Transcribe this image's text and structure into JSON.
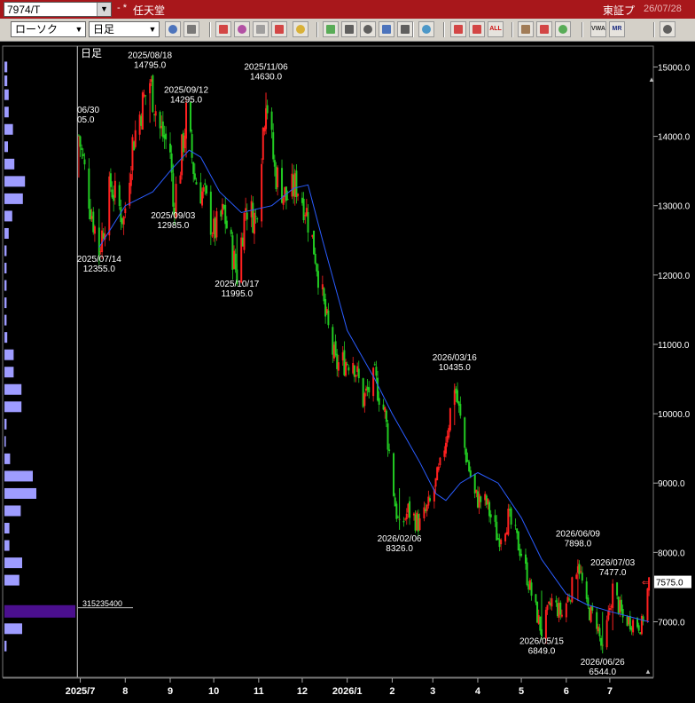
{
  "header": {
    "symbol": "7974/T",
    "mark": "- *",
    "company": "任天堂",
    "exchange": "東証プ",
    "date": "26/07/28"
  },
  "toolbar": {
    "chart_type": "ローソク",
    "period": "日足",
    "buttons": [
      {
        "icon": "search-icon",
        "label": ""
      },
      {
        "icon": "layout-icon",
        "label": ""
      },
      {
        "icon": "cursor-icon",
        "label": ""
      },
      {
        "icon": "zoom-icon",
        "label": ""
      },
      {
        "icon": "table-icon",
        "label": ""
      },
      {
        "icon": "arrows-icon",
        "label": ""
      },
      {
        "icon": "warning-icon",
        "label": ""
      },
      {
        "icon": "pencil-icon",
        "label": ""
      },
      {
        "icon": "line-tool-icon",
        "label": ""
      },
      {
        "icon": "select-tool-icon",
        "label": ""
      },
      {
        "icon": "arrow-tool-icon",
        "label": ""
      },
      {
        "icon": "memo-icon",
        "label": ""
      },
      {
        "icon": "trash-icon",
        "label": ""
      },
      {
        "icon": "candle-icon",
        "label": ""
      },
      {
        "icon": "candle-delete-icon",
        "label": ""
      },
      {
        "icon": "all-delete-icon",
        "label": "ALL"
      },
      {
        "icon": "settings-icon",
        "label": ""
      },
      {
        "icon": "brush-icon",
        "label": ""
      },
      {
        "icon": "color-icon",
        "label": ""
      },
      {
        "icon": "volume-icon",
        "label": "VWAP"
      },
      {
        "icon": "mr-icon",
        "label": "MR"
      },
      {
        "icon": "list-icon",
        "label": ""
      }
    ]
  },
  "colors": {
    "background": "#000000",
    "up_candle": "#ff2020",
    "down_candle": "#22cc22",
    "moving_average": "#2a5cff",
    "volume_profile": "#9e9cff",
    "volume_profile_max": "#4b0f8e",
    "current_price_bg": "#ffffff"
  },
  "chart_data": {
    "type": "candlestick",
    "period_label": "日足",
    "y_ticks": [
      7000.0,
      8000.0,
      9000.0,
      10000.0,
      11000.0,
      12000.0,
      13000.0,
      14000.0,
      15000.0
    ],
    "y_tick_labels": [
      "7000.0",
      "8000.0",
      "9000.0",
      "10000.0",
      "11000.0",
      "12000.0",
      "13000.0",
      "14000.0",
      "15000.0"
    ],
    "ylim": [
      6200,
      15300
    ],
    "x_tick_labels": [
      "2025/7",
      "8",
      "9",
      "10",
      "11",
      "12",
      "2026/1",
      "2",
      "3",
      "4",
      "5",
      "6",
      "7"
    ],
    "x_tick_dates": [
      "2025-07-01",
      "2025-08-01",
      "2025-09-01",
      "2025-10-01",
      "2025-11-01",
      "2025-12-01",
      "2026-01-01",
      "2026-02-01",
      "2026-03-01",
      "2026-04-01",
      "2026-05-01",
      "2026-06-01",
      "2026-07-01"
    ],
    "x_range": [
      "2025-06-27",
      "2026-07-31"
    ],
    "current_price": 7575.0,
    "current_price_label": "7575.0",
    "close_path": [
      [
        "2025-06-30",
        14005
      ],
      [
        "2025-07-08",
        13000
      ],
      [
        "2025-07-14",
        12355
      ],
      [
        "2025-07-22",
        13300
      ],
      [
        "2025-07-31",
        12800
      ],
      [
        "2025-08-06",
        13900
      ],
      [
        "2025-08-12",
        14400
      ],
      [
        "2025-08-18",
        14795
      ],
      [
        "2025-08-25",
        14100
      ],
      [
        "2025-09-01",
        13800
      ],
      [
        "2025-09-03",
        12985
      ],
      [
        "2025-09-08",
        13600
      ],
      [
        "2025-09-12",
        14295
      ],
      [
        "2025-09-18",
        13400
      ],
      [
        "2025-09-25",
        13100
      ],
      [
        "2025-10-01",
        12600
      ],
      [
        "2025-10-08",
        12900
      ],
      [
        "2025-10-17",
        11995
      ],
      [
        "2025-10-23",
        13000
      ],
      [
        "2025-10-30",
        12800
      ],
      [
        "2025-11-06",
        14630
      ],
      [
        "2025-11-12",
        13500
      ],
      [
        "2025-11-20",
        13100
      ],
      [
        "2025-11-27",
        13300
      ],
      [
        "2025-12-03",
        13000
      ],
      [
        "2025-12-10",
        12300
      ],
      [
        "2025-12-17",
        11400
      ],
      [
        "2025-12-24",
        10700
      ],
      [
        "2026-01-05",
        10800
      ],
      [
        "2026-01-12",
        10200
      ],
      [
        "2026-01-20",
        10500
      ],
      [
        "2026-01-27",
        10000
      ],
      [
        "2026-02-03",
        8700
      ],
      [
        "2026-02-06",
        8326
      ],
      [
        "2026-02-12",
        8600
      ],
      [
        "2026-02-20",
        8400
      ],
      [
        "2026-02-27",
        8700
      ],
      [
        "2026-03-06",
        9200
      ],
      [
        "2026-03-12",
        9900
      ],
      [
        "2026-03-16",
        10435
      ],
      [
        "2026-03-23",
        9500
      ],
      [
        "2026-03-30",
        8800
      ],
      [
        "2026-04-07",
        8700
      ],
      [
        "2026-04-15",
        8200
      ],
      [
        "2026-04-22",
        8500
      ],
      [
        "2026-05-01",
        8000
      ],
      [
        "2026-05-08",
        7400
      ],
      [
        "2026-05-15",
        6849
      ],
      [
        "2026-05-22",
        7300
      ],
      [
        "2026-05-29",
        7100
      ],
      [
        "2026-06-05",
        7500
      ],
      [
        "2026-06-09",
        7898
      ],
      [
        "2026-06-15",
        7200
      ],
      [
        "2026-06-22",
        7000
      ],
      [
        "2026-06-26",
        6544
      ],
      [
        "2026-07-03",
        7477
      ],
      [
        "2026-07-10",
        7050
      ],
      [
        "2026-07-17",
        7000
      ],
      [
        "2026-07-23",
        6950
      ],
      [
        "2026-07-28",
        7575
      ]
    ],
    "moving_average": [
      [
        "2025-07-14",
        12400
      ],
      [
        "2025-08-01",
        13000
      ],
      [
        "2025-08-20",
        13200
      ],
      [
        "2025-09-01",
        13500
      ],
      [
        "2025-09-14",
        13800
      ],
      [
        "2025-09-22",
        13700
      ],
      [
        "2025-10-05",
        13200
      ],
      [
        "2025-10-20",
        12900
      ],
      [
        "2025-11-10",
        13000
      ],
      [
        "2025-11-25",
        13250
      ],
      [
        "2025-12-05",
        13300
      ],
      [
        "2025-12-15",
        12500
      ],
      [
        "2026-01-01",
        11200
      ],
      [
        "2026-01-20",
        10500
      ],
      [
        "2026-02-01",
        10000
      ],
      [
        "2026-02-20",
        9300
      ],
      [
        "2026-03-03",
        8850
      ],
      [
        "2026-03-10",
        8750
      ],
      [
        "2026-03-20",
        9000
      ],
      [
        "2026-04-01",
        9150
      ],
      [
        "2026-04-15",
        9000
      ],
      [
        "2026-05-01",
        8500
      ],
      [
        "2026-05-15",
        7900
      ],
      [
        "2026-06-01",
        7400
      ],
      [
        "2026-06-15",
        7250
      ],
      [
        "2026-07-01",
        7150
      ],
      [
        "2026-07-28",
        7000
      ]
    ],
    "annotations": [
      {
        "date_label": "06/30",
        "value_label": "05.0",
        "date": "2025-06-30",
        "value": 14005,
        "pos": "top"
      },
      {
        "date_label": "2025/07/14",
        "value_label": "12355.0",
        "date": "2025-07-14",
        "value": 12355,
        "pos": "bottom"
      },
      {
        "date_label": "2025/08/18",
        "value_label": "14795.0",
        "date": "2025-08-18",
        "value": 14795,
        "pos": "top"
      },
      {
        "date_label": "2025/09/12",
        "value_label": "14295.0",
        "date": "2025-09-12",
        "value": 14295,
        "pos": "top"
      },
      {
        "date_label": "2025/09/03",
        "value_label": "12985.0",
        "date": "2025-09-03",
        "value": 12985,
        "pos": "bottom"
      },
      {
        "date_label": "2025/10/17",
        "value_label": "11995.0",
        "date": "2025-10-17",
        "value": 11995,
        "pos": "bottom"
      },
      {
        "date_label": "2025/11/06",
        "value_label": "14630.0",
        "date": "2025-11-06",
        "value": 14630,
        "pos": "top"
      },
      {
        "date_label": "2026/02/06",
        "value_label": "8326.0",
        "date": "2026-02-06",
        "value": 8326,
        "pos": "bottom"
      },
      {
        "date_label": "2026/03/16",
        "value_label": "10435.0",
        "date": "2026-03-16",
        "value": 10435,
        "pos": "top"
      },
      {
        "date_label": "2026/06/09",
        "value_label": "7898.0",
        "date": "2026-06-09",
        "value": 7898,
        "pos": "top"
      },
      {
        "date_label": "2026/07/03",
        "value_label": "7477.0",
        "date": "2026-07-03",
        "value": 7477,
        "pos": "top"
      },
      {
        "date_label": "2026/05/15",
        "value_label": "6849.0",
        "date": "2026-05-15",
        "value": 6849,
        "pos": "bottom"
      },
      {
        "date_label": "2026/06/26",
        "value_label": "6544.0",
        "date": "2026-06-26",
        "value": 6544,
        "pos": "bottom"
      }
    ],
    "volume_profile": {
      "max_volume_label": "315235400",
      "bins": [
        {
          "price": 15000,
          "rel": 0.04
        },
        {
          "price": 14800,
          "rel": 0.04
        },
        {
          "price": 14600,
          "rel": 0.06
        },
        {
          "price": 14350,
          "rel": 0.06
        },
        {
          "price": 14100,
          "rel": 0.12
        },
        {
          "price": 13850,
          "rel": 0.05
        },
        {
          "price": 13600,
          "rel": 0.14
        },
        {
          "price": 13350,
          "rel": 0.29
        },
        {
          "price": 13100,
          "rel": 0.26
        },
        {
          "price": 12850,
          "rel": 0.11
        },
        {
          "price": 12600,
          "rel": 0.06
        },
        {
          "price": 12350,
          "rel": 0.03
        },
        {
          "price": 12100,
          "rel": 0.03
        },
        {
          "price": 11850,
          "rel": 0.03
        },
        {
          "price": 11600,
          "rel": 0.03
        },
        {
          "price": 11350,
          "rel": 0.03
        },
        {
          "price": 11100,
          "rel": 0.04
        },
        {
          "price": 10850,
          "rel": 0.13
        },
        {
          "price": 10600,
          "rel": 0.13
        },
        {
          "price": 10350,
          "rel": 0.24
        },
        {
          "price": 10100,
          "rel": 0.24
        },
        {
          "price": 9850,
          "rel": 0.03
        },
        {
          "price": 9600,
          "rel": 0.02
        },
        {
          "price": 9350,
          "rel": 0.08
        },
        {
          "price": 9100,
          "rel": 0.4
        },
        {
          "price": 8850,
          "rel": 0.45
        },
        {
          "price": 8600,
          "rel": 0.23
        },
        {
          "price": 8350,
          "rel": 0.07
        },
        {
          "price": 8100,
          "rel": 0.07
        },
        {
          "price": 7850,
          "rel": 0.25
        },
        {
          "price": 7600,
          "rel": 0.21
        },
        {
          "price": 7150,
          "rel": 1.0
        },
        {
          "price": 6900,
          "rel": 0.25
        },
        {
          "price": 6650,
          "rel": 0.03
        }
      ]
    }
  }
}
